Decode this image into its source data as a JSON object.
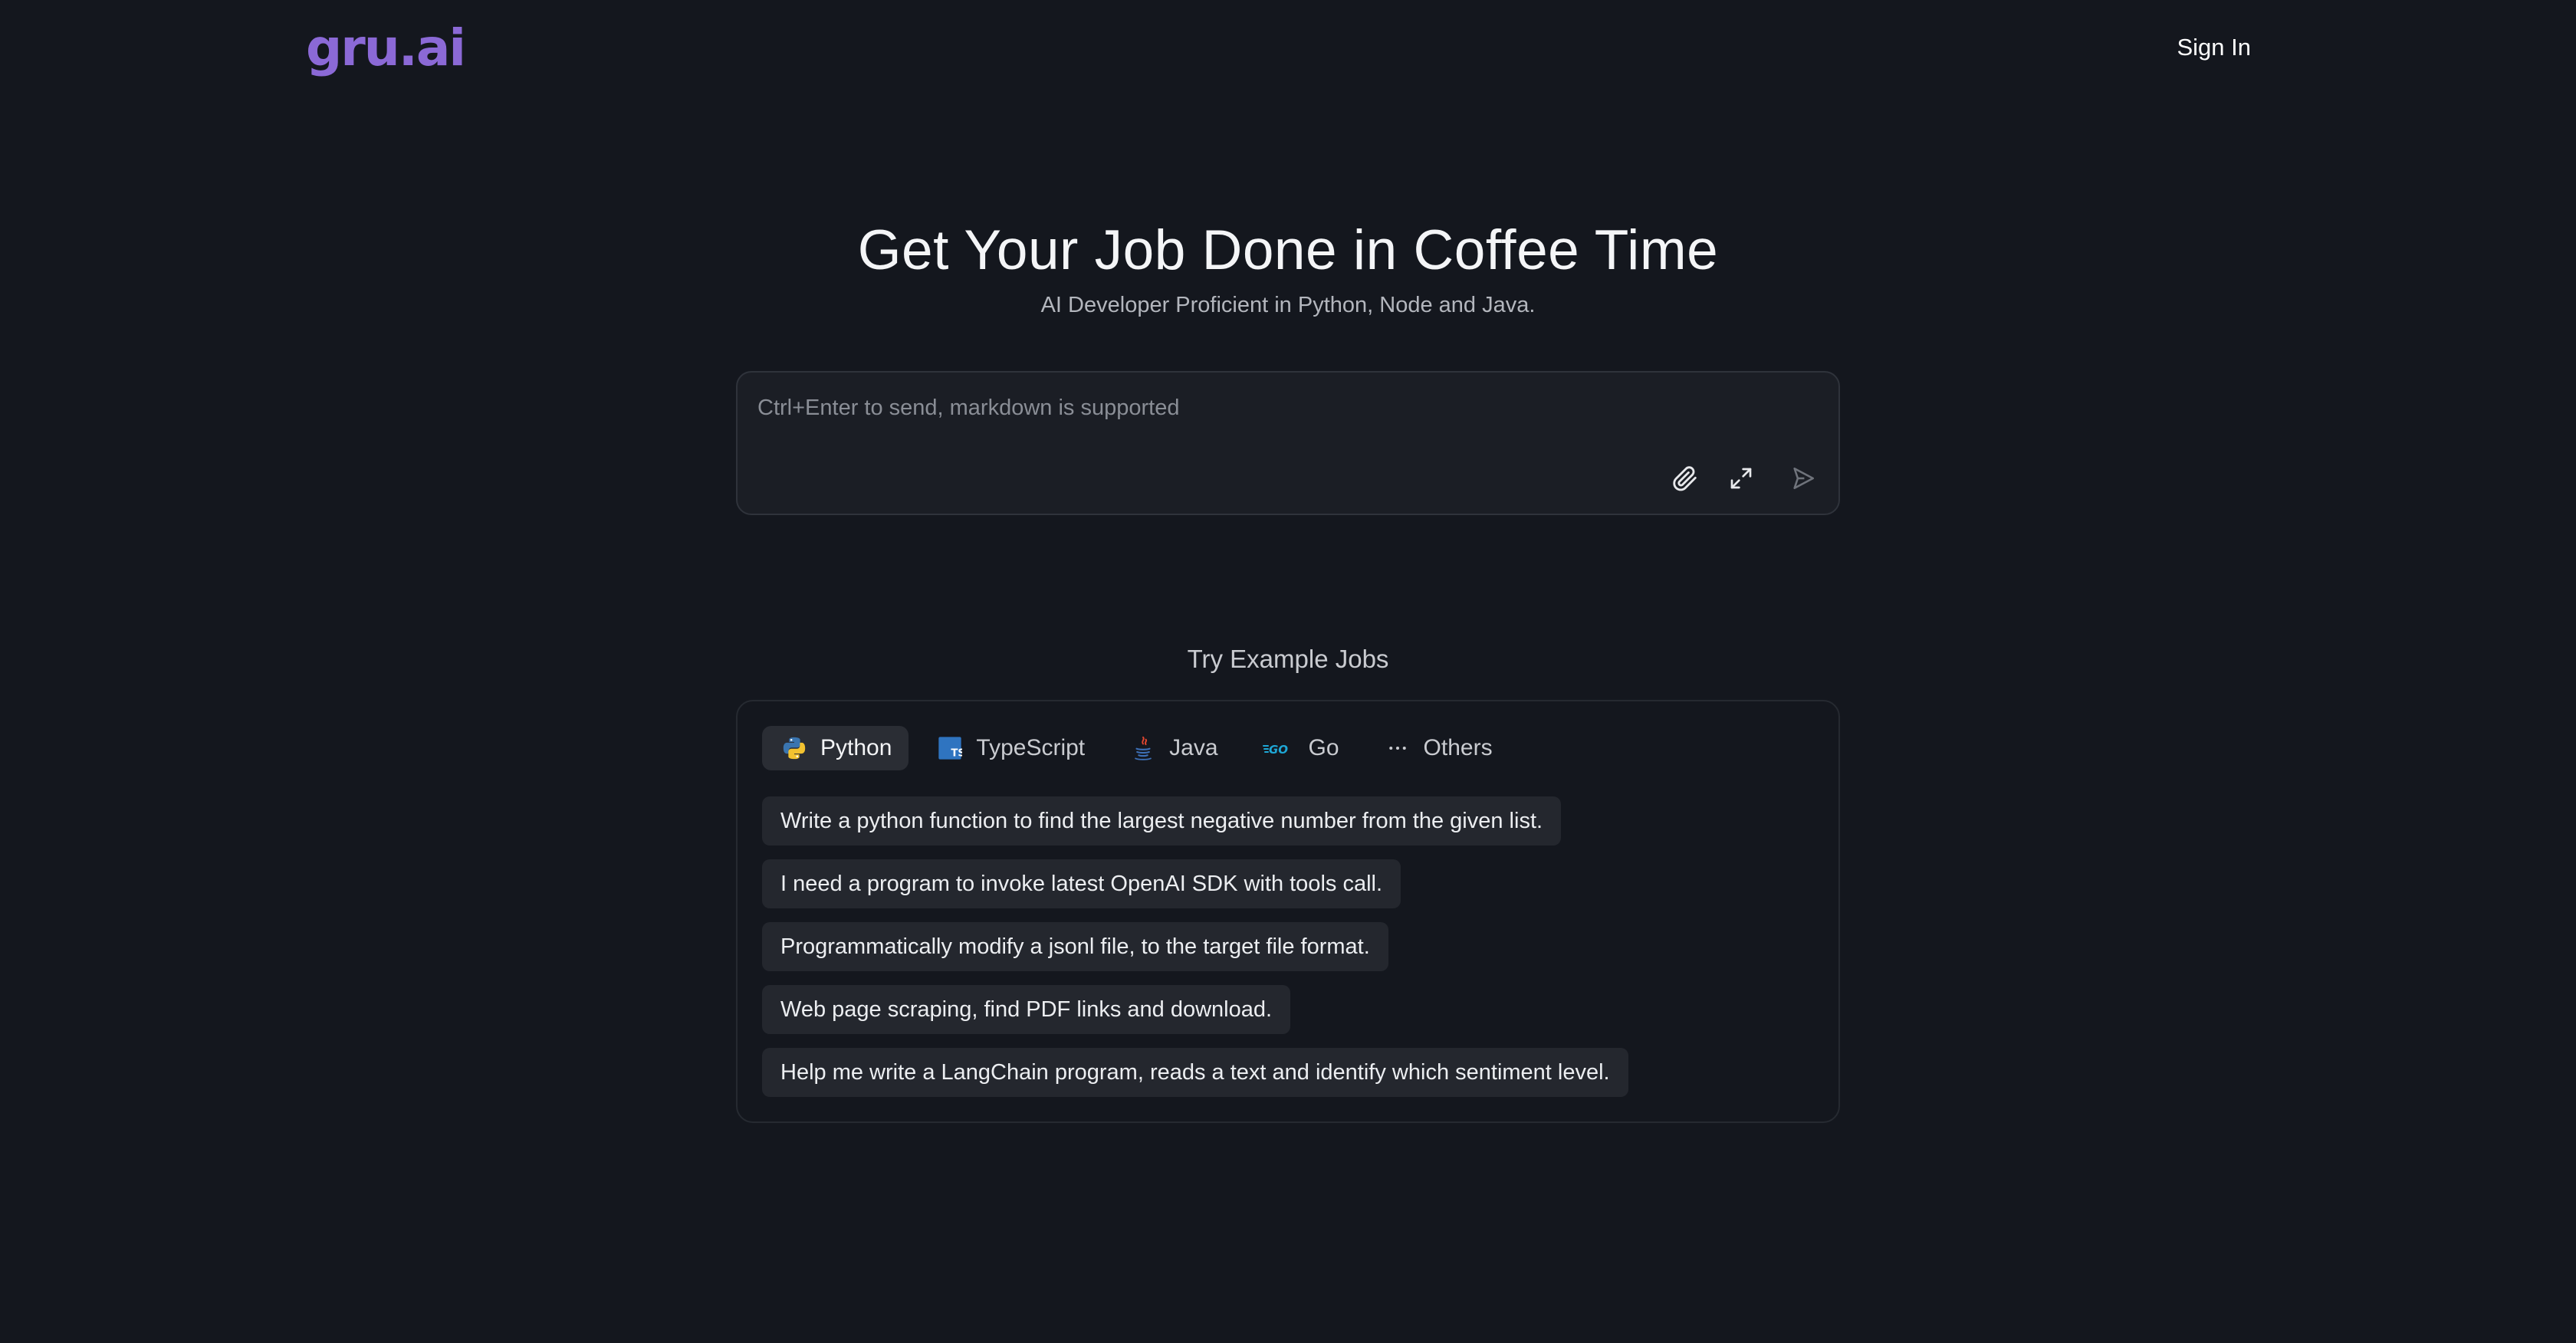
{
  "header": {
    "logo": "gru.ai",
    "sign_in": "Sign In"
  },
  "hero": {
    "title": "Get Your Job Done in Coffee Time",
    "subtitle": "AI Developer Proficient in Python, Node and Java."
  },
  "composer": {
    "placeholder": "Ctrl+Enter to send, markdown is supported",
    "value": "",
    "tools": [
      {
        "icon": "paperclip-icon"
      },
      {
        "icon": "expand-icon"
      },
      {
        "icon": "send-icon"
      }
    ]
  },
  "examples": {
    "heading": "Try Example Jobs",
    "tabs": [
      {
        "label": "Python",
        "icon": "python-icon",
        "active": true
      },
      {
        "label": "TypeScript",
        "icon": "typescript-icon",
        "active": false
      },
      {
        "label": "Java",
        "icon": "java-icon",
        "active": false
      },
      {
        "label": "Go",
        "icon": "go-icon",
        "active": false
      },
      {
        "label": "Others",
        "icon": "ellipsis-icon",
        "active": false
      }
    ],
    "prompts": [
      "Write a python function to find the largest negative number from the given list.",
      "I need a program to invoke latest OpenAI SDK with tools call.",
      "Programmatically modify a jsonl file, to the target file format.",
      "Web page scraping, find PDF links and download.",
      "Help me write a LangChain program, reads a text and identify which sentiment level."
    ]
  },
  "colors": {
    "background": "#14171e",
    "brand": "#8b69d6",
    "card": "#1b1e25",
    "chip": "#24272e",
    "active_tab": "#2a2d34"
  }
}
